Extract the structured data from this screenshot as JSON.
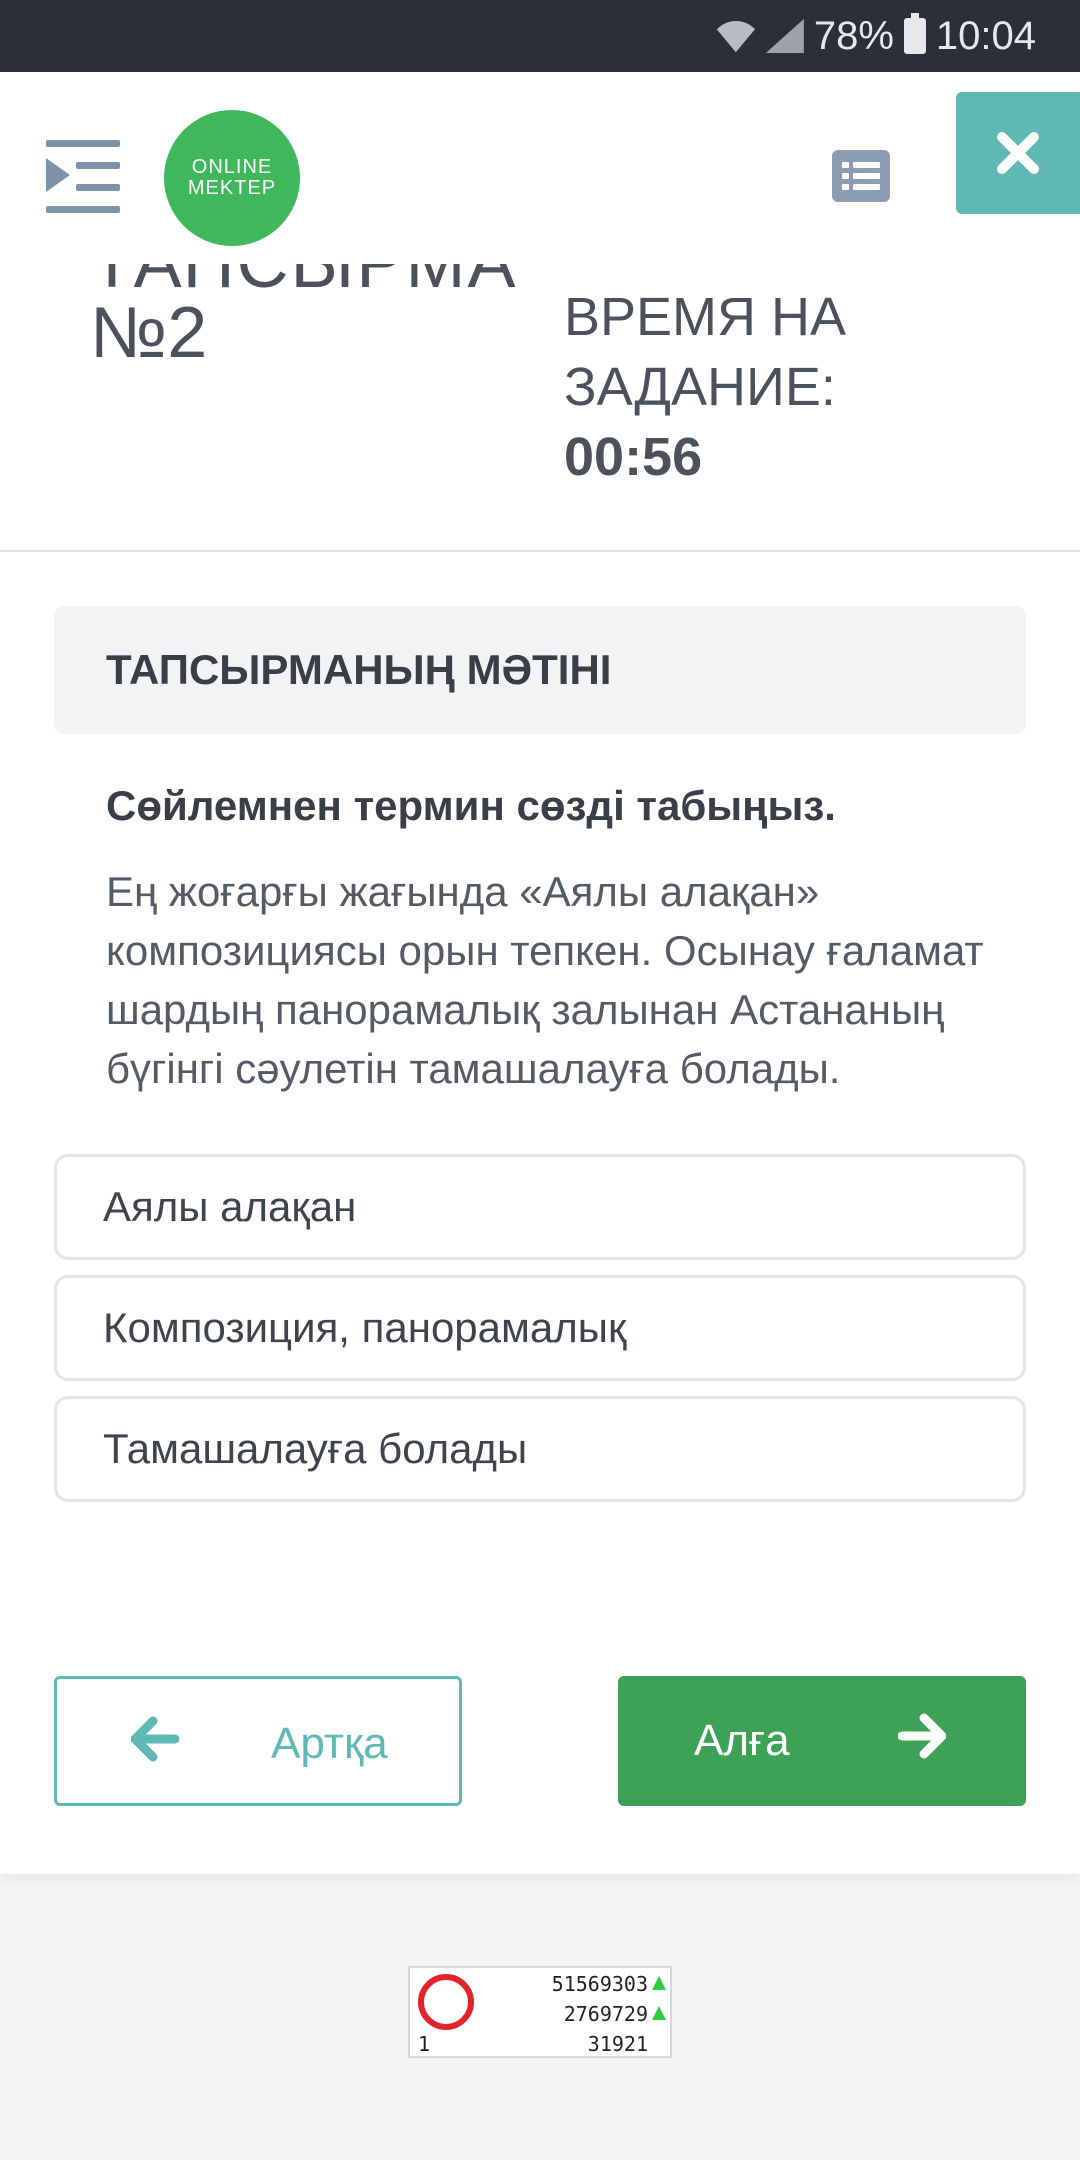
{
  "status_bar": {
    "battery": "78%",
    "time": "10:04"
  },
  "header": {
    "logo_line1": "ONLINE",
    "logo_line2": "MEKTEP"
  },
  "page": {
    "title_partial": "ТАПСЫРМА",
    "title_number": "№2",
    "timer_label_line1": "ВРЕМЯ НА",
    "timer_label_line2": "ЗАДАНИЕ:",
    "timer_value": "00:56"
  },
  "task": {
    "section_title": "ТАПСЫРМАНЫҢ МӘТІНІ",
    "question": "Сөйлемнен термин сөзді табыңыз.",
    "passage": "Ең жоғарғы жағында «Аялы алақан» композициясы орын тепкен. Осынау ғаламат шардың панорамалық залынан Астананың бүгінгі сәулетін тамашалауға болады.",
    "options": [
      "Аялы алақан",
      "Композиция, панорамалық",
      "Тамашалауға болады"
    ]
  },
  "nav": {
    "back_label": "Артқа",
    "next_label": "Алға"
  },
  "counter_widget": {
    "value1": "51569303",
    "value2": "2769729",
    "value3": "31921",
    "rank": "1"
  },
  "colors": {
    "accent_teal": "#5fb8b4",
    "next_green": "#3da156",
    "logo_green": "#3fb75b",
    "status_bar": "#2b2f3a"
  }
}
